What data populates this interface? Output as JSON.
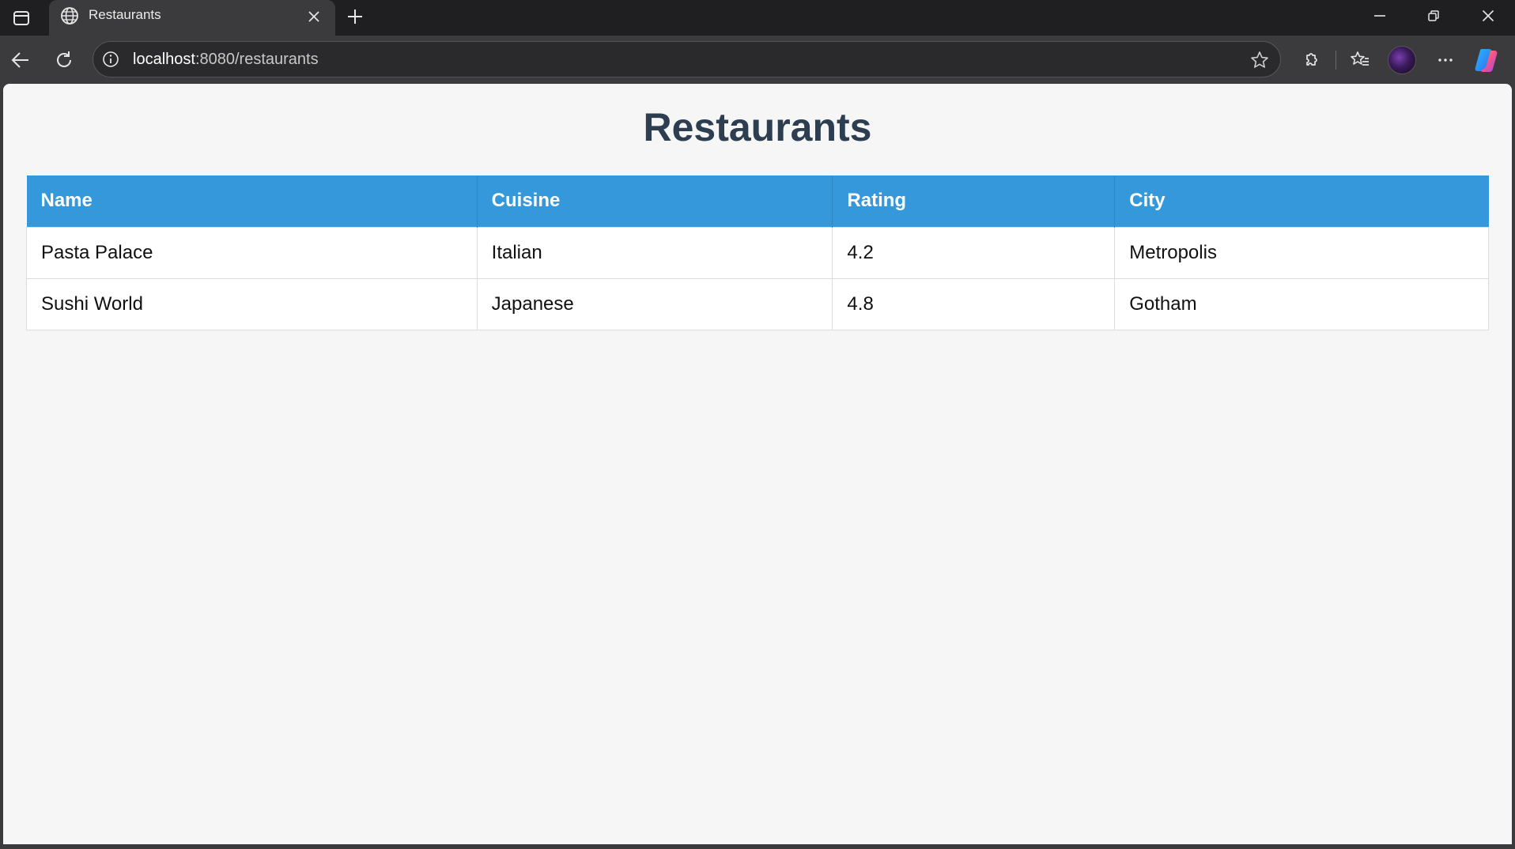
{
  "browser": {
    "tab": {
      "title": "Restaurants"
    },
    "address": {
      "host": "localhost",
      "path": ":8080/restaurants"
    },
    "icons": [
      "sidebar-icon",
      "globe-icon",
      "close-icon",
      "plus-icon",
      "minimize-icon",
      "restore-icon",
      "close-window-icon",
      "back-arrow-icon",
      "refresh-icon",
      "info-icon",
      "star-icon",
      "extensions-icon",
      "favorites-icon",
      "more-icon",
      "copilot-icon"
    ]
  },
  "page": {
    "title": "Restaurants",
    "table": {
      "headers": [
        "Name",
        "Cuisine",
        "Rating",
        "City"
      ],
      "rows": [
        [
          "Pasta Palace",
          "Italian",
          "4.2",
          "Metropolis"
        ],
        [
          "Sushi World",
          "Japanese",
          "4.8",
          "Gotham"
        ]
      ]
    }
  },
  "colors": {
    "header_bg": "#3498db",
    "title_text": "#2c3e50",
    "page_bg": "#f6f6f6"
  }
}
